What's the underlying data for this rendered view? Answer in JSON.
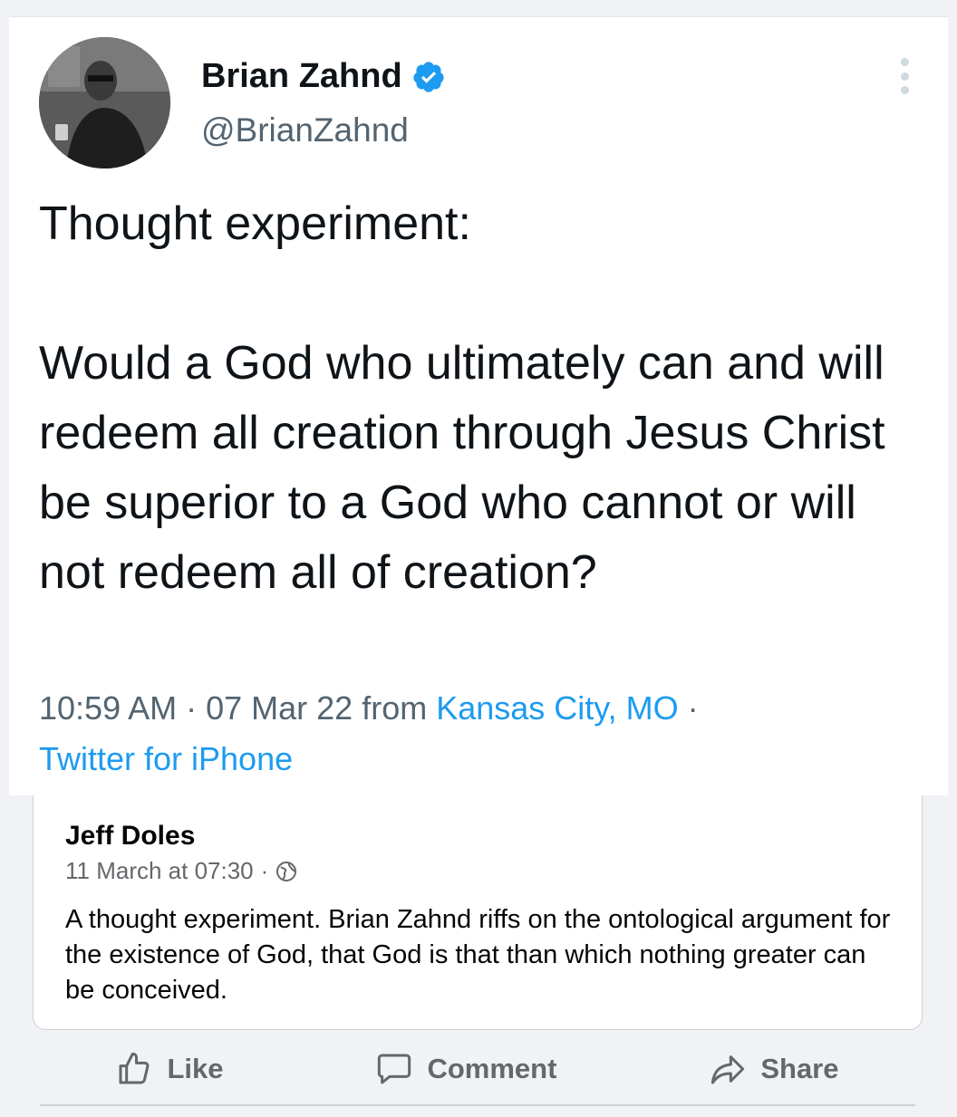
{
  "tweet": {
    "author_name": "Brian Zahnd",
    "author_handle": "@BrianZahnd",
    "text": "Thought experiment:\n\nWould a God who ultimately can and will redeem all creation through Jesus Christ be superior to a God who cannot or will not redeem all of creation?",
    "time": "10:59 AM",
    "date_sep": " · ",
    "date": "07 Mar 22 from ",
    "location": "Kansas City, MO",
    "trailing_sep": " ·",
    "source": "Twitter for iPhone",
    "accent_color": "#1d9bf0"
  },
  "post": {
    "author": "Jeff Doles",
    "timestamp": "11 March at 07:30",
    "timestamp_sep": "·",
    "text": "A thought experiment. Brian Zahnd riffs on the ontological argument for the existence of God, that God is that than which nothing greater can be conceived."
  },
  "actions": {
    "like_label": "Like",
    "comment_label": "Comment",
    "share_label": "Share"
  },
  "icons": [
    "verified-icon",
    "more-icon",
    "globe-icon",
    "like-icon",
    "comment-icon",
    "share-icon"
  ]
}
